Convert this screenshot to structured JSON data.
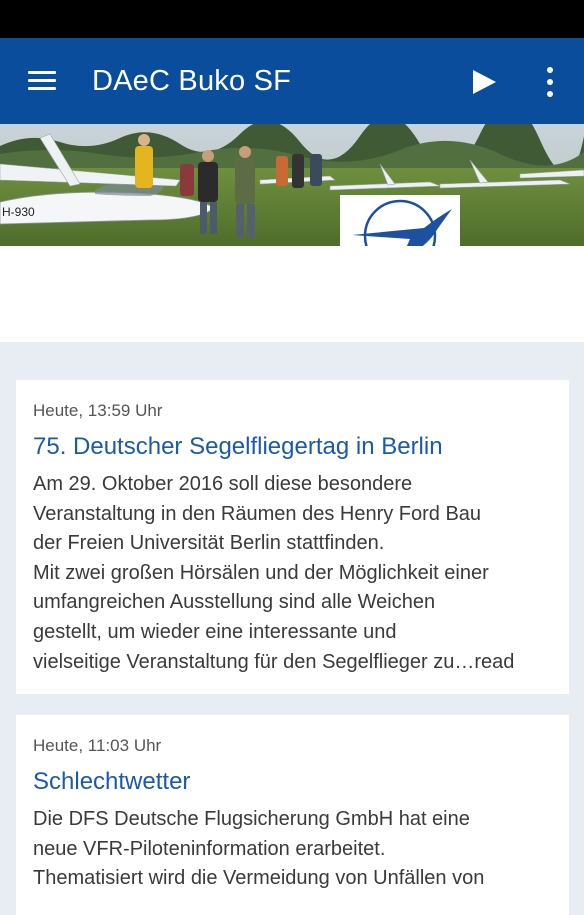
{
  "app": {
    "title": "DAeC Buko SF"
  },
  "toolbar": {
    "menu_icon": "hamburger-menu-icon",
    "play_icon": "play-icon",
    "more_icon": "more-vert-icon"
  },
  "colors": {
    "appbar": "#0b4d9d",
    "headline": "#1a5aa8",
    "background": "#e8edf3"
  },
  "articles": [
    {
      "date": "Heute, 13:59 Uhr",
      "title": "75. Deutscher Segelfliegertag in Berlin",
      "body": "Am 29. Oktober 2016 soll diese besondere\nVeranstaltung in den Räumen des Henry Ford Bau\nder Freien Universität Berlin stattfinden.\nMit zwei großen Hörsälen und der Möglichkeit einer\numfangreichen Ausstellung sind alle Weichen\ngestellt, um wieder eine interessante und\nvielseitige Veranstaltung für den Segelflieger zu…read"
    },
    {
      "date": "Heute, 11:03 Uhr",
      "title": "Schlechtwetter",
      "body": "Die DFS Deutsche Flugsicherung GmbH hat eine\nneue VFR-Piloteninformation erarbeitet.\nThematisiert wird die Vermeidung von Unfällen von"
    }
  ]
}
